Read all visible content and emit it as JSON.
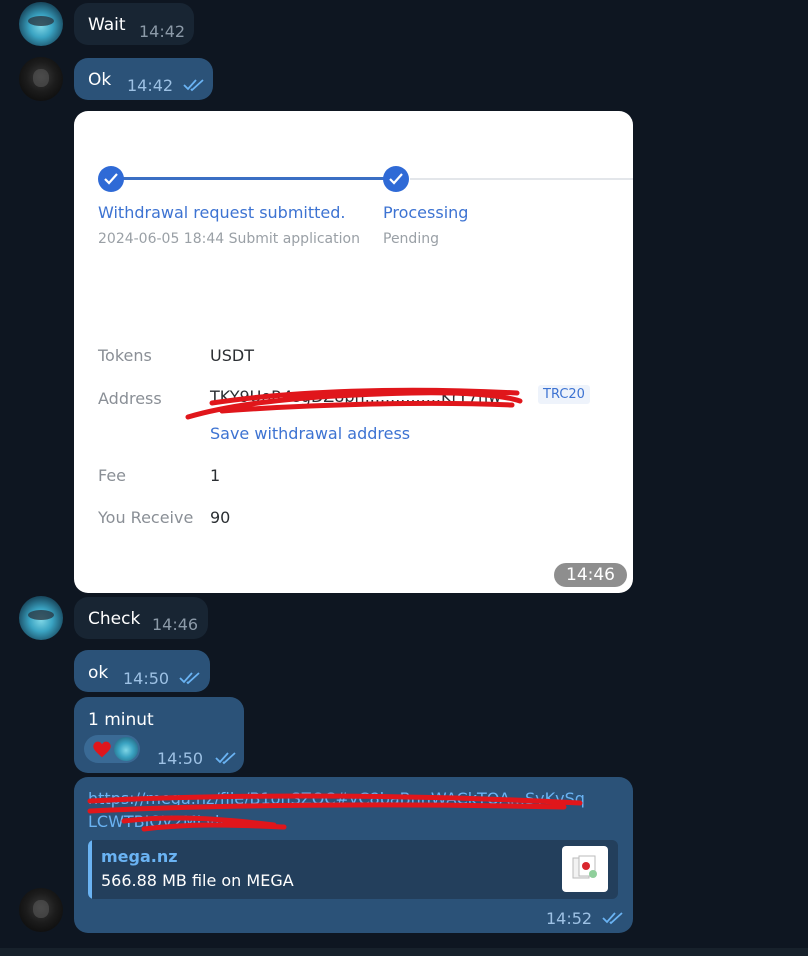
{
  "messages": {
    "wait": {
      "text": "Wait",
      "time": "14:42"
    },
    "ok1": {
      "text": "Ok",
      "time": "14:42"
    },
    "photo": {
      "time": "14:46"
    },
    "check": {
      "text": "Check",
      "time": "14:46"
    },
    "ok2": {
      "text": "ok",
      "time": "14:50"
    },
    "minut": {
      "text": "1 minut",
      "time": "14:50",
      "reaction": "heart-icon"
    },
    "link": {
      "line1": "https://mega.nz/file/B1onSZQC#yC8baBnnWACkTOA...SyKvSq",
      "line2": "LCWTBIOV2MLvin...",
      "preview_site": "mega.nz",
      "preview_desc": "566.88 MB file on MEGA",
      "time": "14:52"
    }
  },
  "withdrawal": {
    "step1_title": "Withdrawal request submitted.",
    "step1_sub": "2024-06-05 18:44 Submit application",
    "step2_title": "Processing",
    "step2_sub": "Pending",
    "tokens_label": "Tokens",
    "tokens_value": "USDT",
    "address_label": "Address",
    "address_value": "TKY9UoR4sgDZ8pn...............KrY7hw",
    "network_tag": "TRC20",
    "save_link": "Save withdrawal address",
    "fee_label": "Fee",
    "fee_value": "1",
    "receive_label": "You Receive",
    "receive_value": "90"
  },
  "colors": {
    "background": "#0e1621",
    "incoming_bubble": "#182533",
    "outgoing_bubble": "#2b5278",
    "accent": "#6ab3f3",
    "step_blue": "#2f6ad6",
    "scribble_red": "#e0161b"
  }
}
